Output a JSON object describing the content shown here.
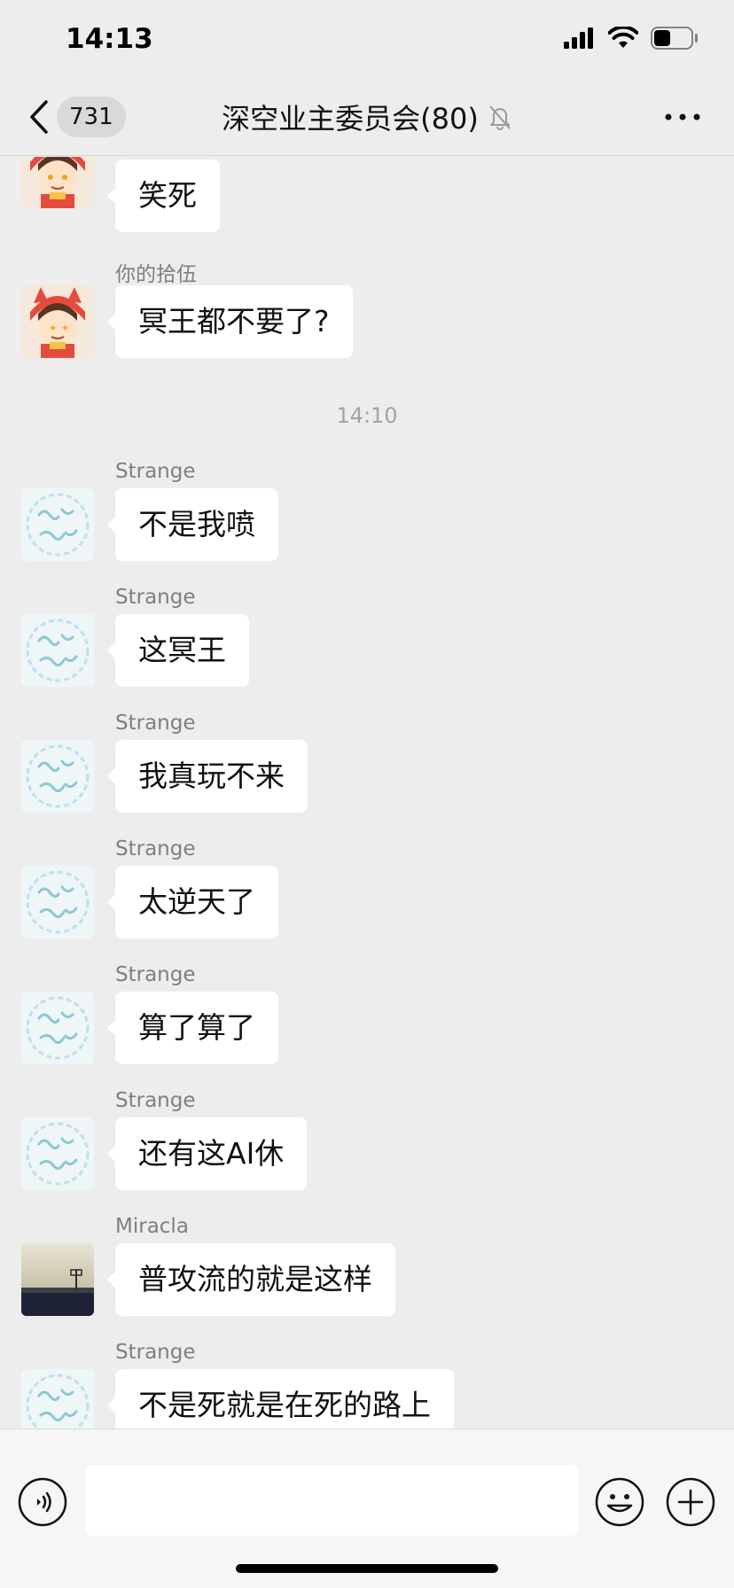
{
  "status_bar": {
    "time": "14:13",
    "icons": [
      "signal-icon",
      "wifi-icon",
      "battery-icon"
    ]
  },
  "nav": {
    "back_icon": "chevron-left-icon",
    "unread_count": "731",
    "title": "深空业主委员会(80)",
    "mute_icon": "bell-off-icon",
    "more_icon": "ellipsis-icon"
  },
  "colors": {
    "background": "#ededed",
    "bubble": "#ffffff",
    "sender": "#7f7f7f",
    "timestamp": "#a3a3a3"
  },
  "messages": [
    {
      "sender": "",
      "text": "笑死",
      "avatar": "anime-avatar"
    },
    {
      "sender": "你的拾伍",
      "text": "冥王都不要了?",
      "avatar": "anime-avatar"
    },
    {
      "timestamp": "14:10"
    },
    {
      "sender": "Strange",
      "text": "不是我喷",
      "avatar": "calligraphy-avatar"
    },
    {
      "sender": "Strange",
      "text": "这冥王",
      "avatar": "calligraphy-avatar"
    },
    {
      "sender": "Strange",
      "text": "我真玩不来",
      "avatar": "calligraphy-avatar"
    },
    {
      "sender": "Strange",
      "text": "太逆天了",
      "avatar": "calligraphy-avatar"
    },
    {
      "sender": "Strange",
      "text": "算了算了",
      "avatar": "calligraphy-avatar"
    },
    {
      "sender": "Strange",
      "text": "还有这AI休",
      "avatar": "calligraphy-avatar"
    },
    {
      "sender": "Miracla",
      "text": "普攻流的就是这样",
      "avatar": "photo-avatar"
    },
    {
      "sender": "Strange",
      "text": "不是死就是在死的路上",
      "avatar": "calligraphy-avatar"
    }
  ],
  "input_bar": {
    "voice_icon": "voice-icon",
    "input_value": "",
    "emoji_icon": "emoji-icon",
    "plus_icon": "plus-icon"
  }
}
